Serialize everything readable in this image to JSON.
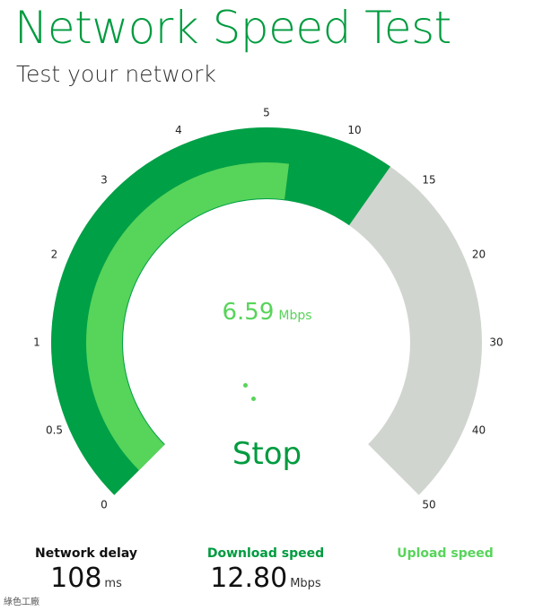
{
  "header": {
    "title": "Network Speed Test",
    "subtitle": "Test your network"
  },
  "gauge": {
    "scale_labels": [
      "0",
      "0.5",
      "1",
      "2",
      "3",
      "4",
      "5",
      "10",
      "15",
      "20",
      "30",
      "40",
      "50"
    ],
    "download_progress_mbps": 12.8,
    "upload_progress_mbps": 6.59,
    "colors": {
      "track": "#d1d5d0",
      "download": "#00a046",
      "upload": "#57d45a"
    }
  },
  "current_speed": {
    "value": "6.59",
    "unit": "Mbps"
  },
  "stop_label": "Stop",
  "stats": {
    "network_delay": {
      "label": "Network delay",
      "value": "108",
      "unit": "ms"
    },
    "download_speed": {
      "label": "Download speed",
      "value": "12.80",
      "unit": "Mbps"
    },
    "upload_speed": {
      "label": "Upload speed",
      "value": "",
      "unit": ""
    }
  },
  "watermark": "綠色工廠",
  "colors": {
    "accent": "#009b3f",
    "light_green": "#57d45a"
  }
}
